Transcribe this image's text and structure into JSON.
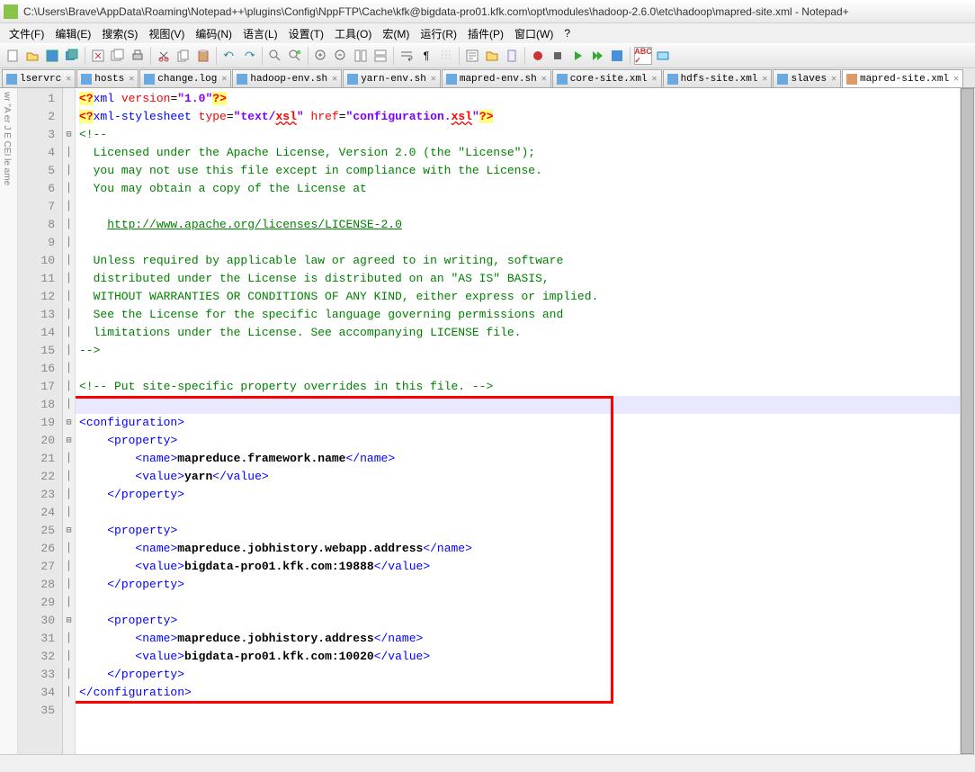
{
  "window": {
    "title": "C:\\Users\\Brave\\AppData\\Roaming\\Notepad++\\plugins\\Config\\NppFTP\\Cache\\kfk@bigdata-pro01.kfk.com\\opt\\modules\\hadoop-2.6.0\\etc\\hadoop\\mapred-site.xml - Notepad+"
  },
  "menus": [
    "文件(F)",
    "编辑(E)",
    "搜索(S)",
    "视图(V)",
    "编码(N)",
    "语言(L)",
    "设置(T)",
    "工具(O)",
    "宏(M)",
    "运行(R)",
    "插件(P)",
    "窗口(W)",
    "?"
  ],
  "tabs": [
    {
      "label": "lservrc",
      "active": false
    },
    {
      "label": "hosts",
      "active": false
    },
    {
      "label": "change.log",
      "active": false
    },
    {
      "label": "hadoop-env.sh",
      "active": false
    },
    {
      "label": "yarn-env.sh",
      "active": false
    },
    {
      "label": "mapred-env.sh",
      "active": false
    },
    {
      "label": "core-site.xml",
      "active": false
    },
    {
      "label": "hdfs-site.xml",
      "active": false
    },
    {
      "label": "slaves",
      "active": false
    },
    {
      "label": "mapred-site.xml",
      "active": true
    }
  ],
  "left_text": "wr \"A er J E CEI le ame",
  "line_count": 35,
  "code": {
    "l1_pi_open": "<?",
    "l1_xml": "xml",
    "l1_version": "version",
    "l1_eq": "=",
    "l1_ver": "\"1.0\"",
    "l1_pi_close": "?>",
    "l2_pi_open": "<?",
    "l2_stylesheet": "xml-stylesheet",
    "l2_type": "type",
    "l2_typestr": "\"text/",
    "l2_xsl": "xsl",
    "l2_q": "\"",
    "l2_href": "href",
    "l2_hrefstr": "\"configuration.",
    "l2_xsl2": "xsl",
    "l2_q2": "\"",
    "l2_pi_close": "?>",
    "l3": "<!--",
    "l4": "  Licensed under the Apache License, Version 2.0 (the \"License\");",
    "l5": "  you may not use this file except in compliance with the License.",
    "l6": "  You may obtain a copy of the License at",
    "l7": "",
    "l8": "    ",
    "l8_link": "http://www.apache.org/licenses/LICENSE-2.0",
    "l9": "",
    "l10": "  Unless required by applicable law or agreed to in writing, software",
    "l11": "  distributed under the License is distributed on an \"AS IS\" BASIS,",
    "l12": "  WITHOUT WARRANTIES OR CONDITIONS OF ANY KIND, either express or implied.",
    "l13": "  See the License for the specific language governing permissions and",
    "l14": "  limitations under the License. See accompanying LICENSE file.",
    "l15": "-->",
    "l16": "",
    "l17": "<!-- Put site-specific property overrides in this file. -->",
    "l18": "",
    "l19_o": "<",
    "l19_t": "configuration",
    "l19_c": ">",
    "l20_o": "    <",
    "l20_t": "property",
    "l20_c": ">",
    "l21_o": "        <",
    "l21_t": "name",
    "l21_c": ">",
    "l21_txt": "mapreduce.framework.name",
    "l21_co": "</",
    "l21_ct": "name",
    "l21_cc": ">",
    "l22_o": "        <",
    "l22_t": "value",
    "l22_c": ">",
    "l22_txt": "yarn",
    "l22_co": "</",
    "l22_ct": "value",
    "l22_cc": ">",
    "l23_o": "    </",
    "l23_t": "property",
    "l23_c": ">",
    "l25_o": "    <",
    "l25_t": "property",
    "l25_c": ">",
    "l26_o": "        <",
    "l26_t": "name",
    "l26_c": ">",
    "l26_txt": "mapreduce.jobhistory.webapp.address",
    "l26_co": "</",
    "l26_ct": "name",
    "l26_cc": ">",
    "l27_o": "        <",
    "l27_t": "value",
    "l27_c": ">",
    "l27_txt": "bigdata-pro01.kfk.com:19888",
    "l27_co": "</",
    "l27_ct": "value",
    "l27_cc": ">",
    "l28_o": "    </",
    "l28_t": "property",
    "l28_c": ">",
    "l30_o": "    <",
    "l30_t": "property",
    "l30_c": ">",
    "l31_o": "        <",
    "l31_t": "name",
    "l31_c": ">",
    "l31_txt": "mapreduce.jobhistory.address",
    "l31_co": "</",
    "l31_ct": "name",
    "l31_cc": ">",
    "l32_o": "        <",
    "l32_t": "value",
    "l32_c": ">",
    "l32_txt": "bigdata-pro01.kfk.com:10020",
    "l32_co": "</",
    "l32_ct": "value",
    "l32_cc": ">",
    "l33_o": "    </",
    "l33_t": "property",
    "l33_c": ">",
    "l34_o": "</",
    "l34_t": "configuration",
    "l34_c": ">"
  }
}
